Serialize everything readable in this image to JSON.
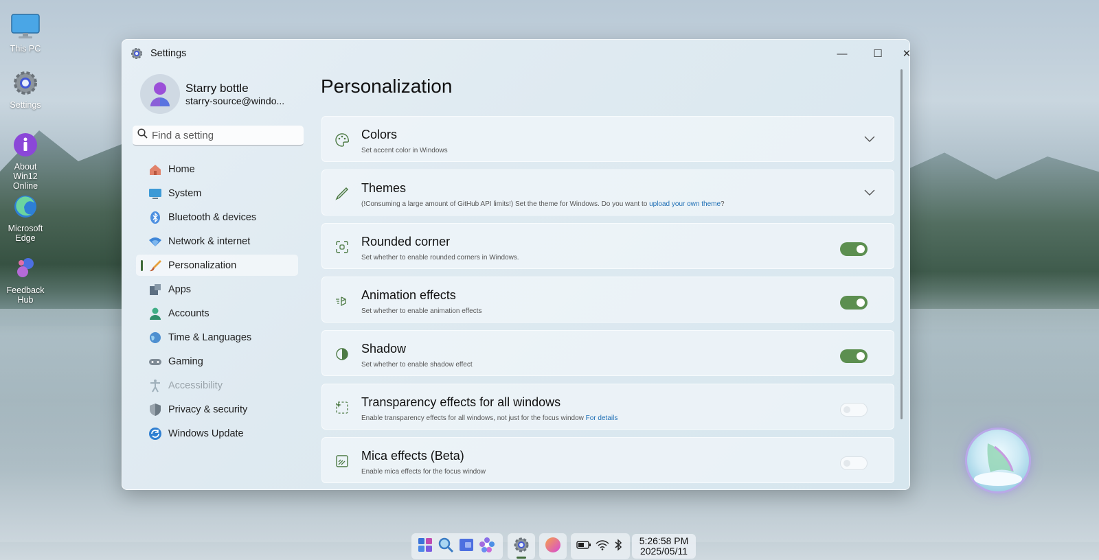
{
  "desktop": {
    "icons": [
      {
        "label": "This PC"
      },
      {
        "label": "Settings"
      },
      {
        "label": "About Win12 Online"
      },
      {
        "label": "Microsoft Edge"
      },
      {
        "label": "Feedback Hub"
      }
    ]
  },
  "window": {
    "title": "Settings",
    "controls": {
      "minimize": "—",
      "maximize": "☐",
      "close": "✕"
    }
  },
  "profile": {
    "name": "Starry bottle",
    "email": "starry-source@windo..."
  },
  "search": {
    "placeholder": "Find a setting"
  },
  "nav": [
    {
      "label": "Home",
      "icon": "home-icon"
    },
    {
      "label": "System",
      "icon": "system-icon"
    },
    {
      "label": "Bluetooth & devices",
      "icon": "bluetooth-icon"
    },
    {
      "label": "Network & internet",
      "icon": "network-icon"
    },
    {
      "label": "Personalization",
      "icon": "brush-icon"
    },
    {
      "label": "Apps",
      "icon": "apps-icon"
    },
    {
      "label": "Accounts",
      "icon": "accounts-icon"
    },
    {
      "label": "Time & Languages",
      "icon": "globe-icon"
    },
    {
      "label": "Gaming",
      "icon": "gamepad-icon"
    },
    {
      "label": "Accessibility",
      "icon": "accessibility-icon"
    },
    {
      "label": "Privacy & security",
      "icon": "shield-icon"
    },
    {
      "label": "Windows Update",
      "icon": "update-icon"
    }
  ],
  "main": {
    "title": "Personalization",
    "cards": [
      {
        "title": "Colors",
        "desc": "Set accent color in Windows",
        "control": "chevron"
      },
      {
        "title": "Themes",
        "desc": "(!Consuming a large amount of GitHub API limits!) Set the theme for Windows. Do you want to ",
        "link": "upload your own theme",
        "desc_after": "?",
        "control": "chevron"
      },
      {
        "title": "Rounded corner",
        "desc": "Set whether to enable rounded corners in Windows.",
        "control": "toggle",
        "on": true
      },
      {
        "title": "Animation effects",
        "desc": "Set whether to enable animation effects",
        "control": "toggle",
        "on": true
      },
      {
        "title": "Shadow",
        "desc": "Set whether to enable shadow effect",
        "control": "toggle",
        "on": true
      },
      {
        "title": "Transparency effects for all windows",
        "desc": "Enable transparency effects for all windows, not just for the focus window ",
        "link": "For details",
        "control": "toggle",
        "on": false
      },
      {
        "title": "Mica effects (Beta)",
        "desc": "Enable mica effects for the focus window",
        "control": "toggle",
        "on": false
      }
    ]
  },
  "taskbar": {
    "time": "5:26:58 PM",
    "date": "2025/05/11"
  },
  "colors": {
    "accent": "#5c8f50",
    "link": "#1f6fb5"
  }
}
